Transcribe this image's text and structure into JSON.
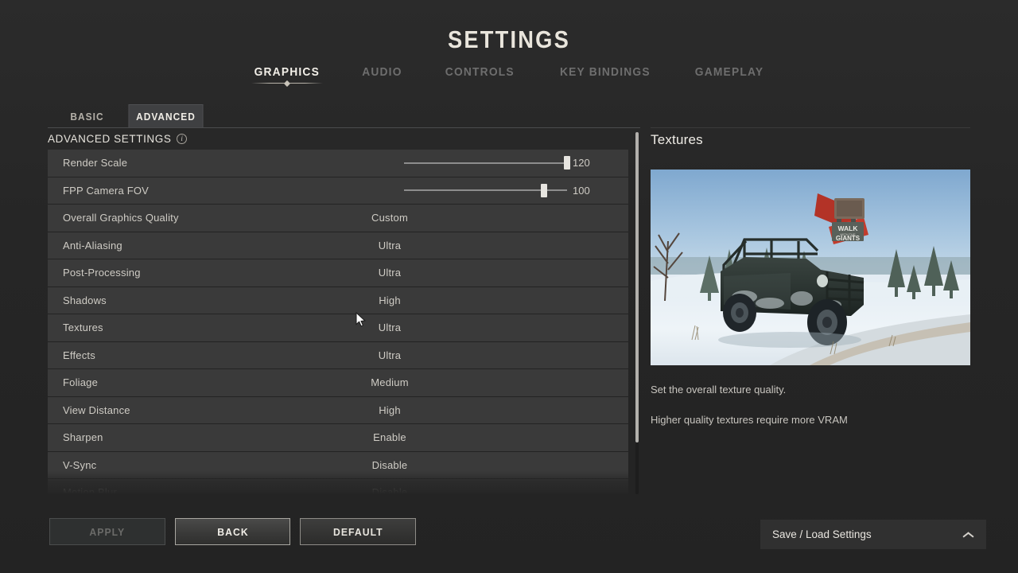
{
  "header": {
    "title": "SETTINGS",
    "tabs": [
      {
        "label": "GRAPHICS",
        "active": true
      },
      {
        "label": "AUDIO",
        "active": false
      },
      {
        "label": "CONTROLS",
        "active": false
      },
      {
        "label": "KEY BINDINGS",
        "active": false
      },
      {
        "label": "GAMEPLAY",
        "active": false
      }
    ]
  },
  "subtabs": [
    {
      "label": "BASIC",
      "active": false
    },
    {
      "label": "ADVANCED",
      "active": true
    }
  ],
  "section": {
    "label": "ADVANCED SETTINGS",
    "info_icon": "info-icon"
  },
  "settings": [
    {
      "name": "Render Scale",
      "type": "slider",
      "value": "120",
      "fill": 100
    },
    {
      "name": "FPP Camera FOV",
      "type": "slider",
      "value": "100",
      "fill": 86
    },
    {
      "name": "Overall Graphics Quality",
      "type": "option",
      "value": "Custom"
    },
    {
      "name": "Anti-Aliasing",
      "type": "option",
      "value": "Ultra"
    },
    {
      "name": "Post-Processing",
      "type": "option",
      "value": "Ultra"
    },
    {
      "name": "Shadows",
      "type": "option",
      "value": "High"
    },
    {
      "name": "Textures",
      "type": "option",
      "value": "Ultra"
    },
    {
      "name": "Effects",
      "type": "option",
      "value": "Ultra"
    },
    {
      "name": "Foliage",
      "type": "option",
      "value": "Medium"
    },
    {
      "name": "View Distance",
      "type": "option",
      "value": "High"
    },
    {
      "name": "Sharpen",
      "type": "option",
      "value": "Enable"
    },
    {
      "name": "V-Sync",
      "type": "option",
      "value": "Disable"
    },
    {
      "name": "Motion Blur",
      "type": "option",
      "value": "Disable"
    }
  ],
  "preview": {
    "title": "Textures",
    "description_line1": "Set the overall texture quality.",
    "description_line2": "Higher quality textures require more VRAM",
    "image_sign_line1": "WALK",
    "image_sign_line2": "WITH THE",
    "image_sign_line3": "GIANTS"
  },
  "buttons": {
    "apply": "APPLY",
    "back": "BACK",
    "default": "DEFAULT"
  },
  "saveload": {
    "label": "Save / Load Settings",
    "icon": "chevron-up-icon"
  },
  "colors": {
    "background": "#262626",
    "row": "#3a3a3a",
    "active_text": "#f2efe8",
    "inactive_text": "#6e6e6e",
    "value_text": "#cfccc5",
    "accent_border": "#a9a7a1"
  }
}
